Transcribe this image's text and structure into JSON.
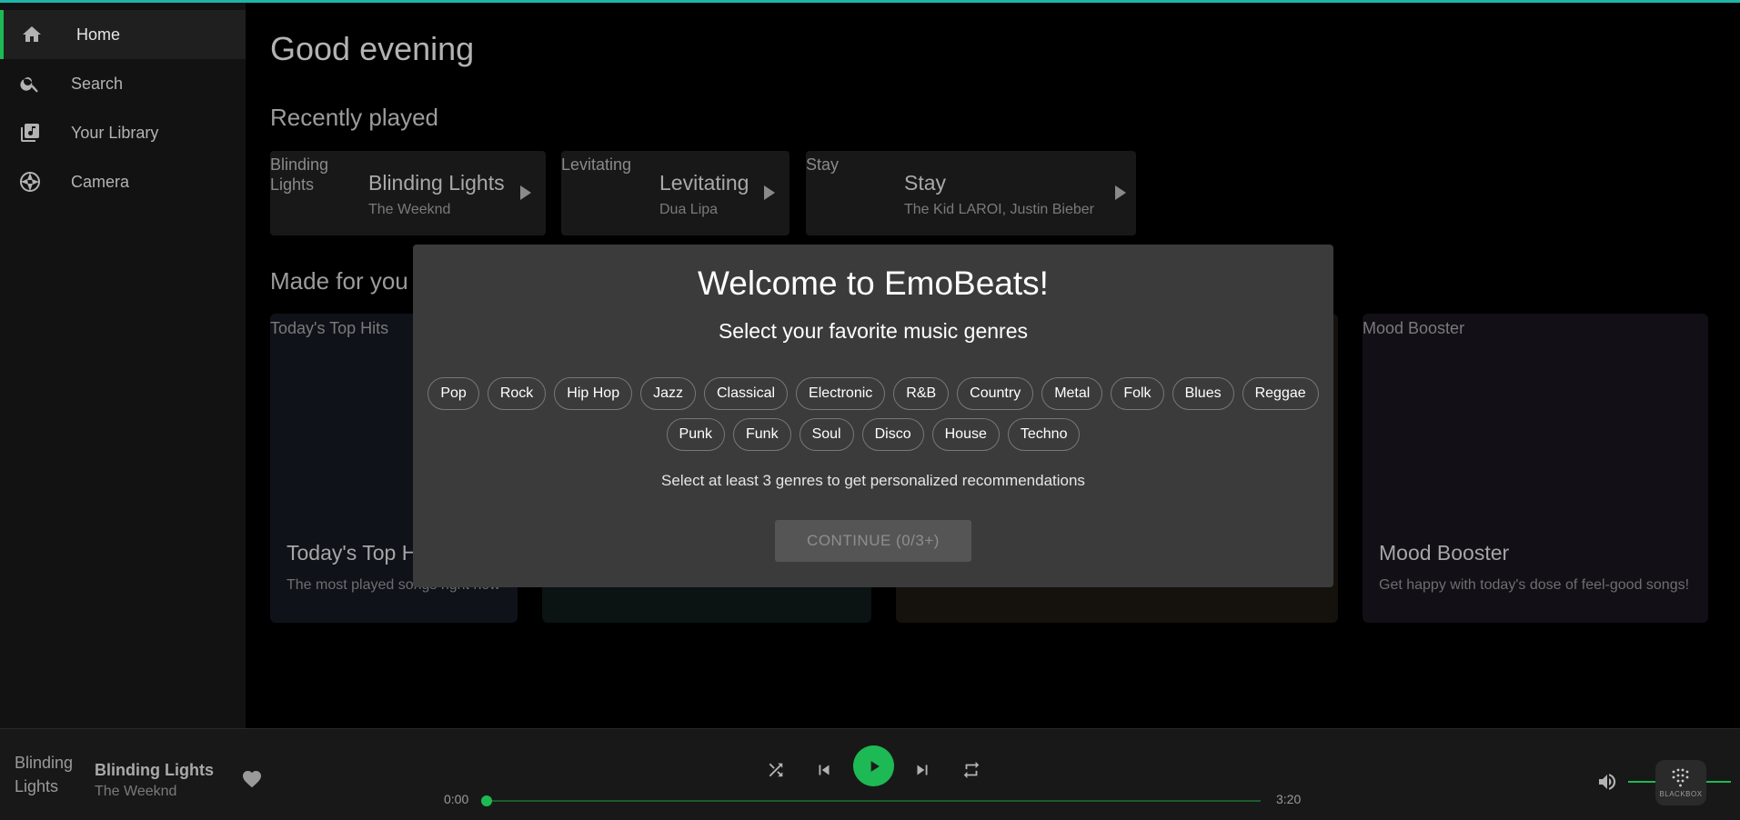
{
  "sidebar": {
    "items": [
      {
        "label": "Home",
        "icon": "home-icon",
        "active": true
      },
      {
        "label": "Search",
        "icon": "search-icon"
      },
      {
        "label": "Your Library",
        "icon": "library-icon"
      },
      {
        "label": "Camera",
        "icon": "camera-icon"
      }
    ]
  },
  "main": {
    "greeting": "Good evening",
    "recently_played_heading": "Recently played",
    "recently_played": [
      {
        "alt": "Blinding Lights",
        "title": "Blinding Lights",
        "artist": "The Weeknd"
      },
      {
        "alt": "Levitating",
        "title": "Levitating",
        "artist": "Dua Lipa"
      },
      {
        "alt": "Stay",
        "title": "Stay",
        "artist": "The Kid LAROI, Justin Bieber"
      }
    ],
    "made_for_you_heading": "Made for you",
    "made_for_you": [
      {
        "alt": "Today's Top Hits",
        "title": "Today's Top Hits",
        "description": "The most played songs right now"
      },
      {
        "alt": "",
        "title": "",
        "description": ""
      },
      {
        "alt": "",
        "title": "",
        "description": ""
      },
      {
        "alt": "Mood Booster",
        "title": "Mood Booster",
        "description": "Get happy with today's dose of feel-good songs!"
      }
    ]
  },
  "modal": {
    "title": "Welcome to EmoBeats!",
    "subtitle": "Select your favorite music genres",
    "genres_row1": [
      "Pop",
      "Rock",
      "Hip Hop",
      "Jazz",
      "Classical",
      "Electronic",
      "R&B",
      "Country",
      "Metal",
      "Folk",
      "Blues",
      "Reggae"
    ],
    "genres_row2": [
      "Punk",
      "Funk",
      "Soul",
      "Disco",
      "House",
      "Techno"
    ],
    "hint": "Select at least 3 genres to get personalized recommendations",
    "continue_label": "CONTINUE (0/3+)"
  },
  "player": {
    "cover_alt": "Blinding Lights",
    "title": "Blinding Lights",
    "artist": "The Weeknd",
    "current_time": "0:00",
    "duration": "3:20",
    "progress": 0,
    "volume": 1.0,
    "badge_text": "BLACKBOX"
  },
  "colors": {
    "accent": "#1db954",
    "top_line": "#1fb5a8",
    "modal_bg": "#3b3b3b",
    "sidebar_bg": "#121212"
  }
}
